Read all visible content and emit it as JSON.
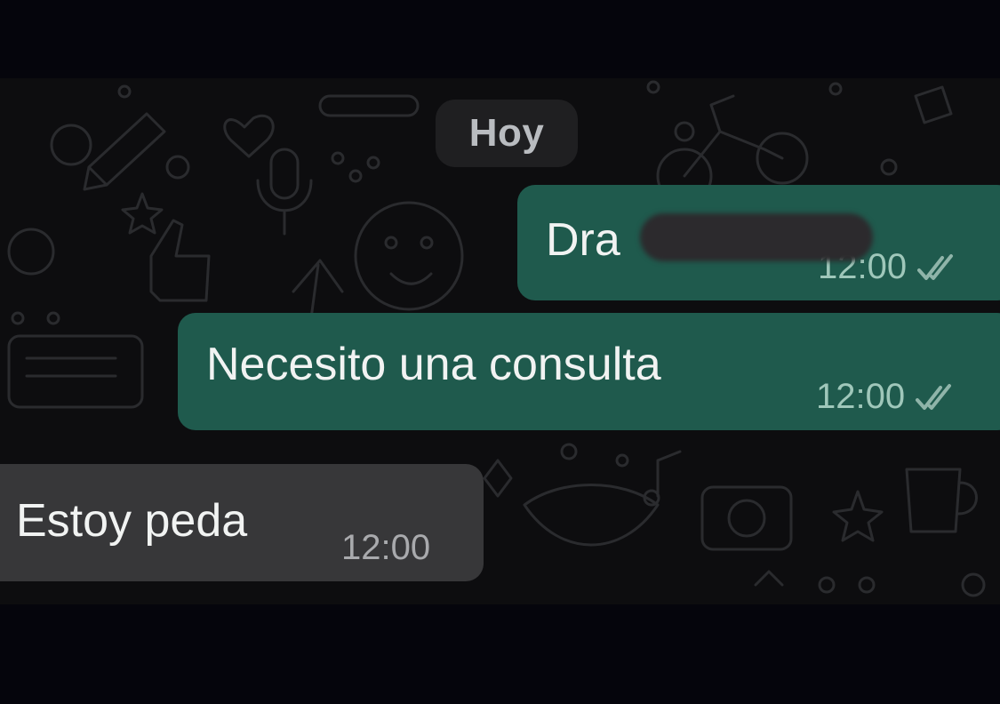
{
  "chat": {
    "date_separator": "Hoy",
    "messages": [
      {
        "direction": "outgoing",
        "text": "Dra",
        "time": "12:00",
        "status_icon": "double-check-icon"
      },
      {
        "direction": "outgoing",
        "text": "Necesito una consulta",
        "time": "12:00",
        "status_icon": "double-check-icon"
      },
      {
        "direction": "incoming",
        "text": "Estoy peda",
        "time": "12:00"
      }
    ]
  },
  "colors": {
    "background": "#0d0d0f",
    "outgoing_bubble": "#1f5a4d",
    "incoming_bubble": "#373739",
    "date_chip": "#1f1f21"
  }
}
